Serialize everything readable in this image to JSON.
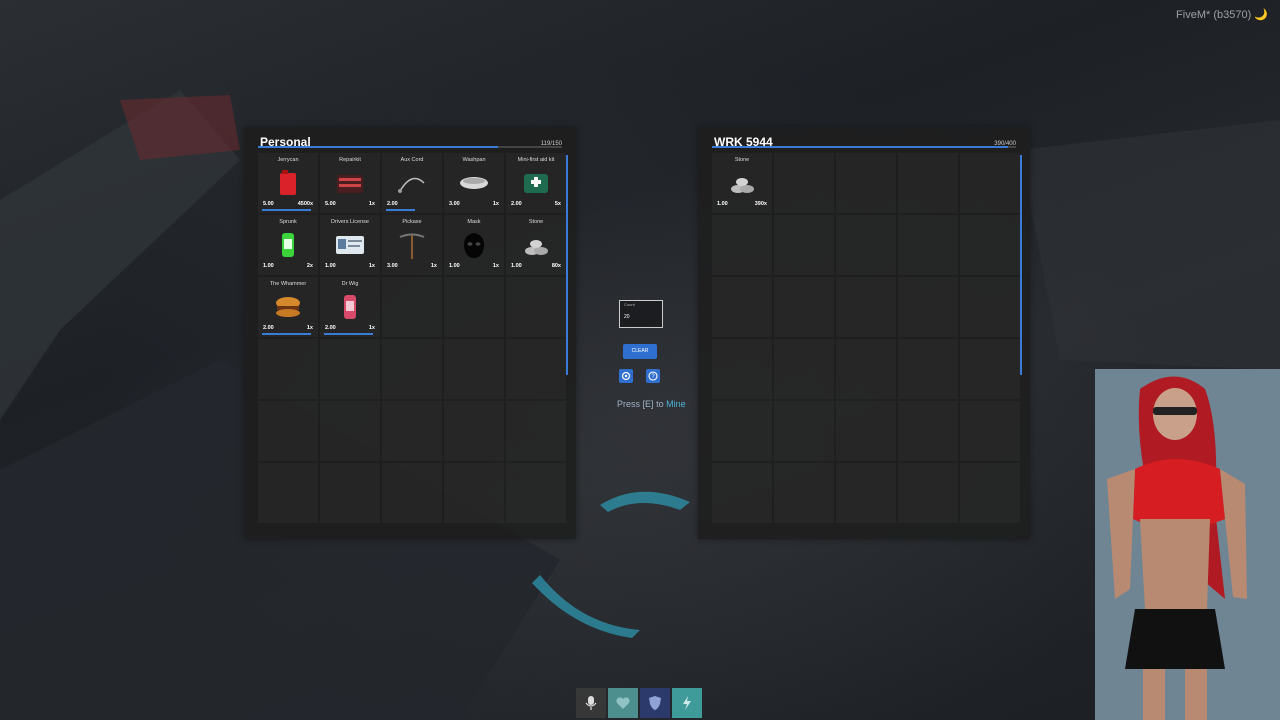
{
  "watermark": "FiveM* (b3570) 🌙",
  "personal": {
    "title": "Personal",
    "weight": "119/150",
    "weight_fraction": 0.79,
    "items": [
      {
        "name": "Jerrycan",
        "weight": "5.00",
        "count": "4500x",
        "icon": "jerrycan-icon",
        "bar": 0.95
      },
      {
        "name": "Repairkit",
        "weight": "5.00",
        "count": "1x",
        "icon": "repairkit-icon",
        "bar": 0
      },
      {
        "name": "Aux Cord",
        "weight": "2.00",
        "count": "",
        "icon": "aux-cord-icon",
        "bar": 0.55
      },
      {
        "name": "Washpan",
        "weight": "3.00",
        "count": "1x",
        "icon": "washpan-icon",
        "bar": 0
      },
      {
        "name": "Mini-first aid kit",
        "weight": "2.00",
        "count": "5x",
        "icon": "first-aid-kit-icon",
        "bar": 0
      },
      {
        "name": "Sprunk",
        "weight": "1.00",
        "count": "2x",
        "icon": "sprunk-can-icon",
        "bar": 0
      },
      {
        "name": "Drivers License",
        "weight": "1.00",
        "count": "1x",
        "icon": "drivers-license-icon",
        "bar": 0
      },
      {
        "name": "Pickaxe",
        "weight": "3.00",
        "count": "1x",
        "icon": "pickaxe-icon",
        "bar": 0
      },
      {
        "name": "Mask",
        "weight": "1.00",
        "count": "1x",
        "icon": "mask-icon",
        "bar": 0
      },
      {
        "name": "Stone",
        "weight": "1.00",
        "count": "80x",
        "icon": "stone-icon",
        "bar": 0
      },
      {
        "name": "The Whammer",
        "weight": "2.00",
        "count": "1x",
        "icon": "burger-icon",
        "bar": 0.95
      },
      {
        "name": "Dr Wig",
        "weight": "2.00",
        "count": "1x",
        "icon": "dr-wig-can-icon",
        "bar": 0.95
      }
    ]
  },
  "other": {
    "title": "WRK 5944",
    "weight": "390/400",
    "weight_fraction": 0.975,
    "items": [
      {
        "name": "Stone",
        "weight": "1.00",
        "count": "390x",
        "icon": "stone-icon",
        "bar": 0
      }
    ]
  },
  "center": {
    "count_label": "Count",
    "count_value": "20",
    "clear_label": "CLEAR",
    "prompt_press": "Press",
    "prompt_key": "[E]",
    "prompt_to": "to",
    "prompt_action": "Mine"
  },
  "colors": {
    "accent": "#3a7bd5",
    "panel": "#1e1e1e"
  },
  "hud": [
    "microphone-icon",
    "heart-icon",
    "shield-icon",
    "energy-icon"
  ]
}
